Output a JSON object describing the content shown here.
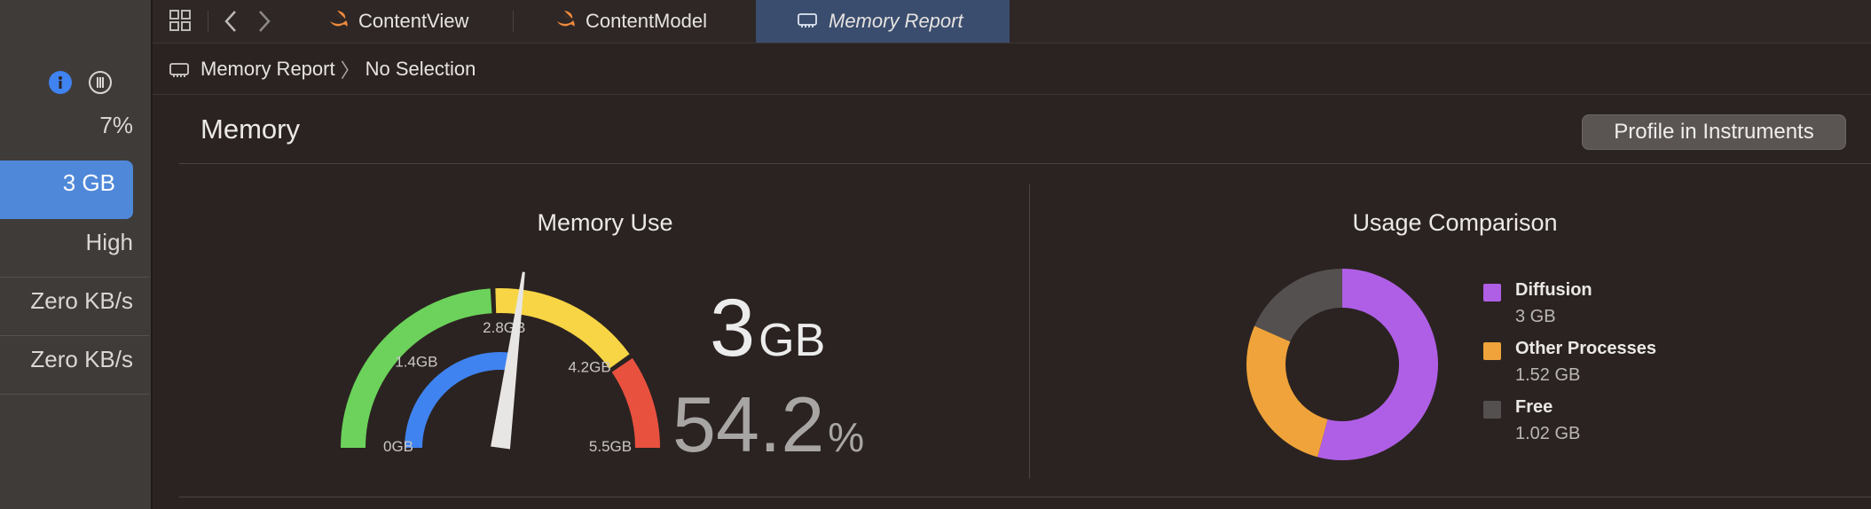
{
  "sidebar": {
    "cpu_value": "7%",
    "memory_value": "3 GB",
    "energy_value": "High",
    "disk_value": "Zero KB/s",
    "network_value": "Zero KB/s"
  },
  "tabs": [
    {
      "label": "ContentView",
      "icon": "swift-icon"
    },
    {
      "label": "ContentModel",
      "icon": "swift-icon"
    },
    {
      "label": "Memory Report",
      "icon": "memory-chip-icon",
      "active": true
    }
  ],
  "pathbar": {
    "root": "Memory Report",
    "separator": "〉",
    "leaf": "No Selection"
  },
  "section": {
    "title": "Memory",
    "profile_button": "Profile in Instruments"
  },
  "memory_use": {
    "title": "Memory Use",
    "value_number": "3",
    "value_unit": "GB",
    "percent_number": "54.2",
    "percent_unit": "%",
    "percent": 54.2,
    "gauge_max_gb": 5.5,
    "inner_fill_fraction": 0.55,
    "tick_labels": [
      "0GB",
      "1.4GB",
      "2.8GB",
      "4.2GB",
      "5.5GB"
    ],
    "colors": {
      "green": "#6cd25b",
      "yellow": "#f7d544",
      "red": "#e9513f",
      "blue": "#3f83f0",
      "needle": "#e8e6e4"
    }
  },
  "usage_comparison": {
    "title": "Usage Comparison",
    "legend": [
      {
        "name": "Diffusion",
        "value": "3 GB",
        "color": "#af5fe6"
      },
      {
        "name": "Other Processes",
        "value": "1.52 GB",
        "color": "#efa33a"
      },
      {
        "name": "Free",
        "value": "1.02 GB",
        "color": "#545050"
      }
    ]
  },
  "chart_data": {
    "type": "pie",
    "title": "Usage Comparison",
    "categories": [
      "Diffusion",
      "Other Processes",
      "Free"
    ],
    "values": [
      3,
      1.52,
      1.02
    ],
    "units": "GB",
    "colors": [
      "#af5fe6",
      "#efa33a",
      "#545050"
    ]
  }
}
